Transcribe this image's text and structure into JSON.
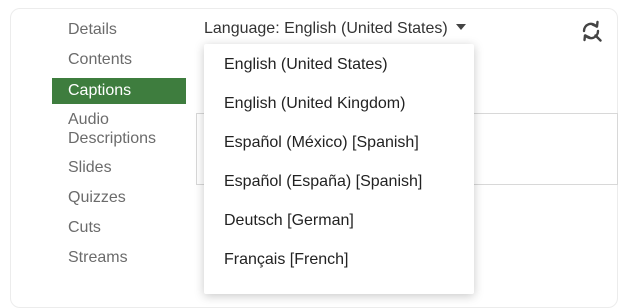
{
  "sidebar": {
    "items": [
      {
        "label": "Details"
      },
      {
        "label": "Contents"
      },
      {
        "label": "Captions"
      },
      {
        "label_line1": "Audio",
        "label_line2": "Descriptions"
      },
      {
        "label": "Slides"
      },
      {
        "label": "Quizzes"
      },
      {
        "label": "Cuts"
      },
      {
        "label": "Streams"
      }
    ],
    "active": "Captions"
  },
  "language_select": {
    "label": "Language: English (United States)",
    "options": [
      "English (United States)",
      "English (United Kingdom)",
      "Español (México) [Spanish]",
      "Español (España) [Spanish]",
      "Deutsch [German]",
      "Français [French]"
    ]
  },
  "toolbar": {
    "refresh_icon": "refresh-icon"
  },
  "colors": {
    "active_tab": "#3e7d3e"
  }
}
